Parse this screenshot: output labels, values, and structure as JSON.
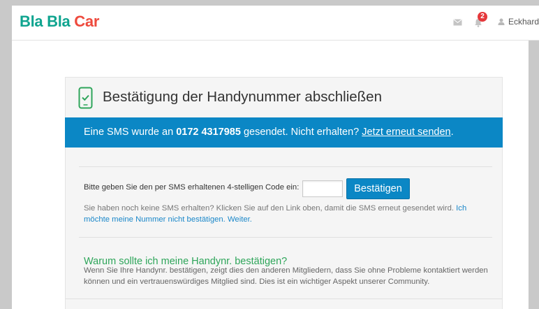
{
  "header": {
    "logo": {
      "part1": "Bla Bla",
      "part2": "Car"
    },
    "icons": {
      "messages": "envelope-icon",
      "notifications": "bell-icon",
      "user": "user-icon"
    },
    "notification_count": "2",
    "user_name": "Eckhard"
  },
  "verification": {
    "title_icon": "phone-check-icon",
    "title": "Bestätigung der Handynummer abschließen",
    "banner": {
      "text_before": "Eine SMS wurde an ",
      "phone_number": "0172 4317985",
      "text_after": " gesendet. Nicht erhalten? ",
      "resend_link": "Jetzt erneut senden",
      "period": "."
    },
    "code_form": {
      "label": "Bitte geben Sie den per SMS erhaltenen 4-stelligen Code ein:",
      "code_value": "",
      "submit_label": "Bestätigen"
    },
    "help": {
      "text": "Sie haben noch keine SMS erhalten? Klicken Sie auf den Link oben, damit die SMS erneut gesendet wird. ",
      "skip_link": "Ich möchte meine Nummer nicht bestätigen. Weiter."
    },
    "why": {
      "heading": "Warum sollte ich meine Handynr. bestätigen?",
      "text": "Wenn Sie Ihre Handynr. bestätigen, zeigt dies den anderen Mitgliedern, dass Sie ohne Probleme kontaktiert werden können und ein vertrauenswürdiges Mitglied sind. Dies ist ein wichtiger Aspekt unserer Community."
    }
  },
  "colors": {
    "brand_teal": "#0fa48f",
    "brand_red": "#ee4a3d",
    "primary_blue": "#0b87c5",
    "link_blue": "#1a87c9",
    "success_green": "#2ea55a",
    "badge_red": "#e5383b"
  }
}
